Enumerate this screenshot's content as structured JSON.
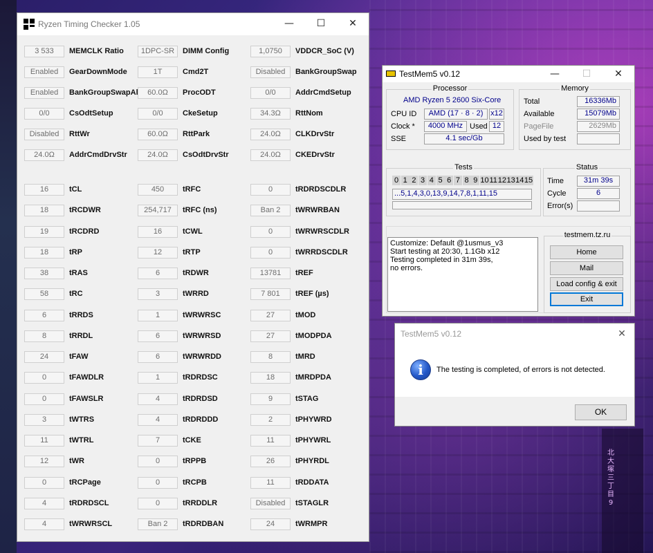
{
  "rtc": {
    "title": "Ryzen Timing Checker 1.05",
    "rows": [
      [
        {
          "v": "3 533",
          "l": "MEMCLK Ratio"
        },
        {
          "v": "1DPC-SR",
          "l": "DIMM Config"
        },
        {
          "v": "1,0750",
          "l": "VDDCR_SoC (V)"
        }
      ],
      [
        {
          "v": "Enabled",
          "l": "GearDownMode"
        },
        {
          "v": "1T",
          "l": "Cmd2T"
        },
        {
          "v": "Disabled",
          "l": "BankGroupSwap"
        }
      ],
      [
        {
          "v": "Enabled",
          "l": "BankGroupSwapAlt"
        },
        {
          "v": "60.0Ω",
          "l": "ProcODT"
        },
        {
          "v": "0/0",
          "l": "AddrCmdSetup"
        }
      ],
      [
        {
          "v": "0/0",
          "l": "CsOdtSetup"
        },
        {
          "v": "0/0",
          "l": "CkeSetup"
        },
        {
          "v": "34.3Ω",
          "l": "RttNom"
        }
      ],
      [
        {
          "v": "Disabled",
          "l": "RttWr"
        },
        {
          "v": "60.0Ω",
          "l": "RttPark"
        },
        {
          "v": "24.0Ω",
          "l": "CLKDrvStr"
        }
      ],
      [
        {
          "v": "24.0Ω",
          "l": "AddrCmdDrvStr"
        },
        {
          "v": "24.0Ω",
          "l": "CsOdtDrvStr"
        },
        {
          "v": "24.0Ω",
          "l": "CKEDrvStr"
        }
      ],
      [
        {
          "v": "16",
          "l": "tCL"
        },
        {
          "v": "450",
          "l": "tRFC"
        },
        {
          "v": "0",
          "l": "tRDRDSCDLR"
        }
      ],
      [
        {
          "v": "18",
          "l": "tRCDWR"
        },
        {
          "v": "254,717",
          "l": "tRFC (ns)"
        },
        {
          "v": "Ban 2",
          "l": "tWRWRBAN"
        }
      ],
      [
        {
          "v": "19",
          "l": "tRCDRD"
        },
        {
          "v": "16",
          "l": "tCWL"
        },
        {
          "v": "0",
          "l": "tWRWRSCDLR"
        }
      ],
      [
        {
          "v": "18",
          "l": "tRP"
        },
        {
          "v": "12",
          "l": "tRTP"
        },
        {
          "v": "0",
          "l": "tWRRDSCDLR"
        }
      ],
      [
        {
          "v": "38",
          "l": "tRAS"
        },
        {
          "v": "6",
          "l": "tRDWR"
        },
        {
          "v": "13781",
          "l": "tREF"
        }
      ],
      [
        {
          "v": "58",
          "l": "tRC"
        },
        {
          "v": "3",
          "l": "tWRRD"
        },
        {
          "v": "7 801",
          "l": "tREF (µs)"
        }
      ],
      [
        {
          "v": "6",
          "l": "tRRDS"
        },
        {
          "v": "1",
          "l": "tWRWRSC"
        },
        {
          "v": "27",
          "l": "tMOD"
        }
      ],
      [
        {
          "v": "8",
          "l": "tRRDL"
        },
        {
          "v": "6",
          "l": "tWRWRSD"
        },
        {
          "v": "27",
          "l": "tMODPDA"
        }
      ],
      [
        {
          "v": "24",
          "l": "tFAW"
        },
        {
          "v": "6",
          "l": "tWRWRDD"
        },
        {
          "v": "8",
          "l": "tMRD"
        }
      ],
      [
        {
          "v": "0",
          "l": "tFAWDLR"
        },
        {
          "v": "1",
          "l": "tRDRDSC"
        },
        {
          "v": "18",
          "l": "tMRDPDA"
        }
      ],
      [
        {
          "v": "0",
          "l": "tFAWSLR"
        },
        {
          "v": "4",
          "l": "tRDRDSD"
        },
        {
          "v": "9",
          "l": "tSTAG"
        }
      ],
      [
        {
          "v": "3",
          "l": "tWTRS"
        },
        {
          "v": "4",
          "l": "tRDRDDD"
        },
        {
          "v": "2",
          "l": "tPHYWRD"
        }
      ],
      [
        {
          "v": "11",
          "l": "tWTRL"
        },
        {
          "v": "7",
          "l": "tCKE"
        },
        {
          "v": "11",
          "l": "tPHYWRL"
        }
      ],
      [
        {
          "v": "12",
          "l": "tWR"
        },
        {
          "v": "0",
          "l": "tRPPB"
        },
        {
          "v": "26",
          "l": "tPHYRDL"
        }
      ],
      [
        {
          "v": "0",
          "l": "tRCPage"
        },
        {
          "v": "0",
          "l": "tRCPB"
        },
        {
          "v": "11",
          "l": "tRDDATA"
        }
      ],
      [
        {
          "v": "4",
          "l": "tRDRDSCL"
        },
        {
          "v": "0",
          "l": "tRRDDLR"
        },
        {
          "v": "Disabled",
          "l": "tSTAGLR"
        }
      ],
      [
        {
          "v": "4",
          "l": "tWRWRSCL"
        },
        {
          "v": "Ban 2",
          "l": "tRDRDBAN"
        },
        {
          "v": "24",
          "l": "tWRMPR"
        }
      ]
    ]
  },
  "tm5": {
    "title": "TestMem5 v0.12",
    "processor": {
      "group": "Processor",
      "name": "AMD Ryzen 5 2600 Six-Core",
      "cpuid_label": "CPU ID",
      "cpuid_value": "AMD  (17 · 8 · 2)",
      "cpuid_threads": "x12",
      "clock_label": "Clock *",
      "clock_value": "4000 MHz",
      "used_label": "Used",
      "used_value": "12",
      "sse_label": "SSE",
      "sse_value": "4.1 sec/Gb"
    },
    "memory": {
      "group": "Memory",
      "total_label": "Total",
      "total_value": "16336Mb",
      "available_label": "Available",
      "available_value": "15079Mb",
      "pagefile_label": "PageFile",
      "pagefile_value": "2629Mb",
      "usedby_label": "Used by test",
      "usedby_value": ""
    },
    "tests": {
      "group": "Tests",
      "numbers": [
        "0",
        "1",
        "2",
        "3",
        "4",
        "5",
        "6",
        "7",
        "8",
        "9",
        "10",
        "11",
        "12",
        "13",
        "14",
        "15"
      ],
      "sequence": "...5,1,4,3,0,13,9,14,7,8,1,11,15"
    },
    "status": {
      "group": "Status",
      "time_label": "Time",
      "time_value": "31m 39s",
      "cycle_label": "Cycle",
      "cycle_value": "6",
      "errors_label": "Error(s)",
      "errors_value": ""
    },
    "log": [
      "Customize: Default @1usmus_v3",
      "Start testing at 20:30, 1.1Gb x12",
      "Testing completed in 31m 39s,",
      "no errors."
    ],
    "site": "testmem.tz.ru",
    "buttons": {
      "home": "Home",
      "mail": "Mail",
      "load": "Load config & exit",
      "exit": "Exit"
    }
  },
  "dialog": {
    "title": "TestMem5 v0.12",
    "message": "The testing is completed, of errors is not detected.",
    "ok": "OK"
  },
  "background": {
    "sign": "北大塚三丁目9"
  },
  "colors": {
    "value_blue": "#00008b",
    "focus": "#0078d7"
  }
}
